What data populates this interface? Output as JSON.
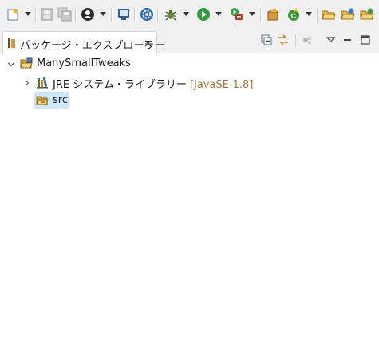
{
  "toolbar": {
    "items": [
      {
        "name": "new-icon"
      },
      {
        "name": "save-icon"
      },
      {
        "name": "save-all-icon"
      },
      {
        "name": "perspective-icon"
      },
      {
        "name": "console-icon"
      },
      {
        "name": "settings-icon"
      },
      {
        "name": "debug-icon"
      },
      {
        "name": "run-icon"
      },
      {
        "name": "run-external-icon"
      },
      {
        "name": "new-package-icon"
      },
      {
        "name": "refresh-icon"
      },
      {
        "name": "open-folder-icon"
      },
      {
        "name": "open-project-icon"
      },
      {
        "name": "open-type-icon"
      }
    ]
  },
  "view": {
    "tab_label": "パッケージ・エクスプローラー",
    "tab_close": "close-icon"
  },
  "tree": {
    "project": {
      "label": "ManySmallTweaks",
      "expanded": true
    },
    "jre": {
      "label": "JRE システム・ライブラリー",
      "decoration": "[JavaSE-1.8]",
      "expanded": false
    },
    "src": {
      "label": "src",
      "selected": true
    }
  },
  "colors": {
    "toolbar_bg": "#f0f0f0",
    "selection": "#cce8ff",
    "decoration": "#a07a3c"
  }
}
